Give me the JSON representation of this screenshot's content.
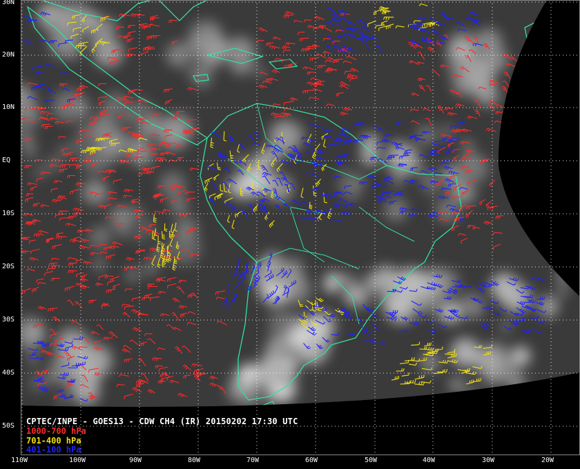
{
  "caption": "CPTEC/INPE - GOES13 - CDW CH4 (IR) 20150202 17:30 UTC",
  "legend": [
    {
      "label": "1000-700 hPa",
      "color": "#ff2a2a"
    },
    {
      "label": "701-400 hPa",
      "color": "#f0e010"
    },
    {
      "label": "401-100 hPa",
      "color": "#2020ff"
    }
  ],
  "lat_labels": [
    "30N",
    "20N",
    "10N",
    "EQ",
    "10S",
    "20S",
    "30S",
    "40S",
    "50S"
  ],
  "lon_labels": [
    "110W",
    "100W",
    "90W",
    "80W",
    "70W",
    "60W",
    "50W",
    "40W",
    "30W",
    "20W"
  ],
  "colors": {
    "coastline": "#33e0a0",
    "grid": "#ffffff",
    "background": "#000000",
    "cloud_base": "#3a3a3a"
  }
}
